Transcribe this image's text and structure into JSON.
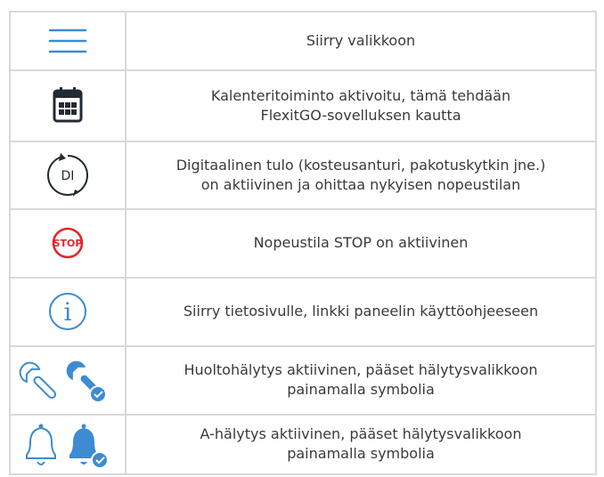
{
  "colors": {
    "blue": "#3d8bd1",
    "red": "#e2242b",
    "dark": "#222a33",
    "border": "#d9d9d9",
    "text": "#3a3a3a"
  },
  "rows": [
    {
      "icon": "hamburger-menu-icon",
      "lines": [
        "Siirry valikkoon"
      ]
    },
    {
      "icon": "calendar-icon",
      "lines": [
        "Kalenteritoiminto aktivoitu, tämä tehdään",
        "FlexitGO-sovelluksen kautta"
      ]
    },
    {
      "icon": "digital-input-icon",
      "icon_text": "DI",
      "lines": [
        "Digitaalinen tulo (kosteusanturi, pakotuskytkin jne.)",
        "on aktiivinen ja ohittaa nykyisen nopeustilan"
      ]
    },
    {
      "icon": "stop-icon",
      "icon_text": "STOP",
      "lines": [
        "Nopeustila STOP on aktiivinen"
      ]
    },
    {
      "icon": "info-icon",
      "icon_text": "i",
      "lines": [
        "Siirry tietosivulle, linkki paneelin käyttöohjeeseen"
      ]
    },
    {
      "icon": "wrench-icon",
      "lines": [
        "Huoltohälytys aktiivinen, pääset hälytysvalikkoon",
        "painamalla symbolia"
      ]
    },
    {
      "icon": "bell-icon",
      "lines": [
        "A-hälytys aktiivinen, pääset hälytysvalikkoon",
        "painamalla symbolia"
      ]
    }
  ]
}
